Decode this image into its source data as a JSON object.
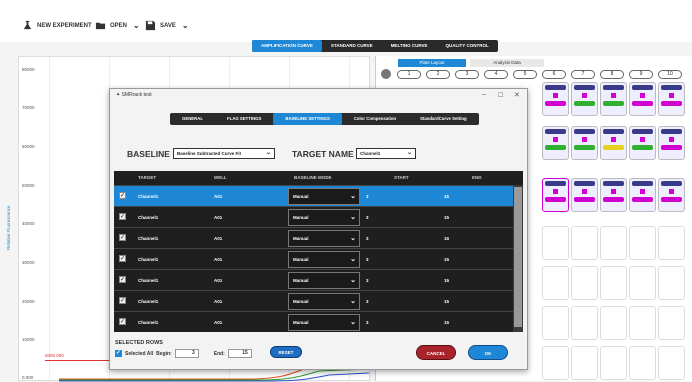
{
  "toolbar": {
    "new_experiment": "NEW EXPERIMENT",
    "open": "OPEN",
    "save": "SAVE"
  },
  "main_tabs": [
    "AMPLIFICATION CURVE",
    "STANDARD CURVE",
    "MELTING CURVE",
    "QUALITY CONTROL"
  ],
  "chart": {
    "y_ticks": [
      "80000",
      "70000",
      "60000",
      "50000",
      "40000",
      "30000",
      "20000",
      "10000",
      "0.000"
    ],
    "y_title": "Relative Fluorescence",
    "threshold_label": "5000.000"
  },
  "plate": {
    "tabs": [
      "Plate Layout",
      "Analysis Data"
    ],
    "columns": [
      "1",
      "2",
      "3",
      "4",
      "5",
      "6",
      "7",
      "8",
      "9",
      "10"
    ]
  },
  "dialog": {
    "title": "SMRrack test",
    "tabs": [
      "GENERAL",
      "FLAG SETTINGS",
      "BASELINE SETTINGS",
      "Color Compensation",
      "StandardCurve Setting"
    ],
    "baseline_label": "BASELINE",
    "baseline_value": "Baseline Subtracted Curve Fit",
    "target_name_label": "TARGET NAME",
    "target_name_value": "Channel1",
    "table": {
      "headers": [
        "TARGET",
        "WELL",
        "BASELINE MODE",
        "START",
        "END"
      ],
      "rows": [
        {
          "target": "Channel1",
          "well": "A01",
          "mode": "Manual",
          "start": "3",
          "end": "15"
        },
        {
          "target": "Channel1",
          "well": "A01",
          "mode": "Manual",
          "start": "3",
          "end": "15"
        },
        {
          "target": "Channel1",
          "well": "A01",
          "mode": "Manual",
          "start": "3",
          "end": "15"
        },
        {
          "target": "Channel1",
          "well": "A01",
          "mode": "Manual",
          "start": "3",
          "end": "15"
        },
        {
          "target": "Channel1",
          "well": "A01",
          "mode": "Manual",
          "start": "3",
          "end": "15"
        },
        {
          "target": "Channel1",
          "well": "A01",
          "mode": "Manual",
          "start": "3",
          "end": "15"
        },
        {
          "target": "Channel1",
          "well": "A01",
          "mode": "Manual",
          "start": "3",
          "end": "15"
        }
      ]
    },
    "selected_rows": {
      "title": "SELECTED ROWS",
      "select_all": "Selected All",
      "begin_label": "Begin:",
      "begin_value": "3",
      "end_label": "End:",
      "end_value": "15",
      "reset": "RESET"
    },
    "cancel": "CANCEL",
    "ok": "OK"
  },
  "colors": {
    "accent": "#1e88d6",
    "cancel": "#a8232a",
    "table_bg": "#1f1f1f"
  }
}
